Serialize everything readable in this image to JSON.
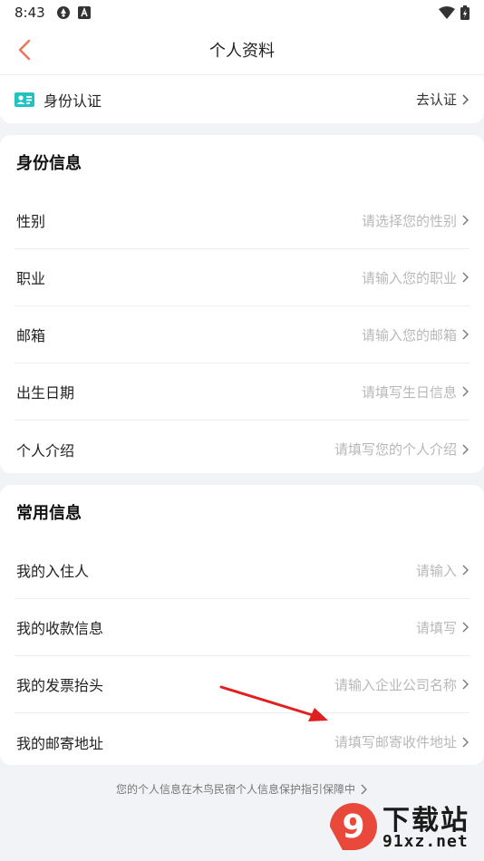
{
  "status_bar": {
    "time": "8:43"
  },
  "nav": {
    "title": "个人资料"
  },
  "verify": {
    "label": "身份认证",
    "action": "去认证"
  },
  "identity_section": {
    "title": "身份信息",
    "rows": [
      {
        "label": "性别",
        "value": "请选择您的性别"
      },
      {
        "label": "职业",
        "value": "请输入您的职业"
      },
      {
        "label": "邮箱",
        "value": "请输入您的邮箱"
      },
      {
        "label": "出生日期",
        "value": "请填写生日信息"
      },
      {
        "label": "个人介绍",
        "value": "请填写您的个人介绍"
      }
    ]
  },
  "common_section": {
    "title": "常用信息",
    "rows": [
      {
        "label": "我的入住人",
        "value": "请输入"
      },
      {
        "label": "我的收款信息",
        "value": "请填写"
      },
      {
        "label": "我的发票抬头",
        "value": "请输入企业公司名称"
      },
      {
        "label": "我的邮寄地址",
        "value": "请填写邮寄收件地址"
      }
    ]
  },
  "footer": {
    "note": "您的个人信息在木鸟民宿个人信息保护指引保障中"
  },
  "watermark": {
    "top": "下载站",
    "bottom": "91xz.net",
    "badge": "9"
  },
  "colors": {
    "accent": "#f0705a",
    "id_icon": "#22c2c2",
    "arrow": "#e02020",
    "placeholder": "#b8b8b8"
  }
}
